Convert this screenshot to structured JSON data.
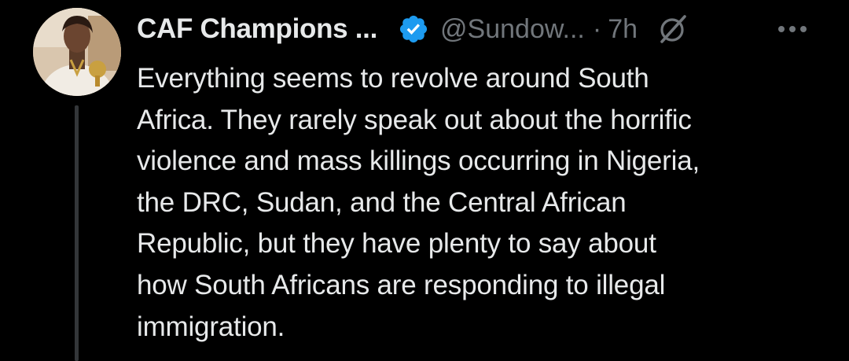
{
  "author": {
    "display_name": "CAF Champions ...",
    "handle": "@Sundow...",
    "separator": "·",
    "time": "7h",
    "verified": true,
    "avatar_icon": "profile-photo"
  },
  "icons": {
    "verified": "verified-badge-icon",
    "grok": "grok-slash-icon",
    "more": "more-horizontal-icon"
  },
  "colors": {
    "background": "#000000",
    "text_primary": "#e7e9ea",
    "text_secondary": "#71767b",
    "verified_blue": "#1d9bf0",
    "thread_line": "#333639"
  },
  "tweet": {
    "lines": [
      "Everything seems to revolve around South",
      "Africa. They rarely speak out about the horrific",
      "violence and mass killings occurring in Nigeria,",
      "the DRC, Sudan, and the Central African",
      "Republic, but they have plenty to say about",
      "how South Africans are responding to illegal",
      "immigration."
    ]
  }
}
